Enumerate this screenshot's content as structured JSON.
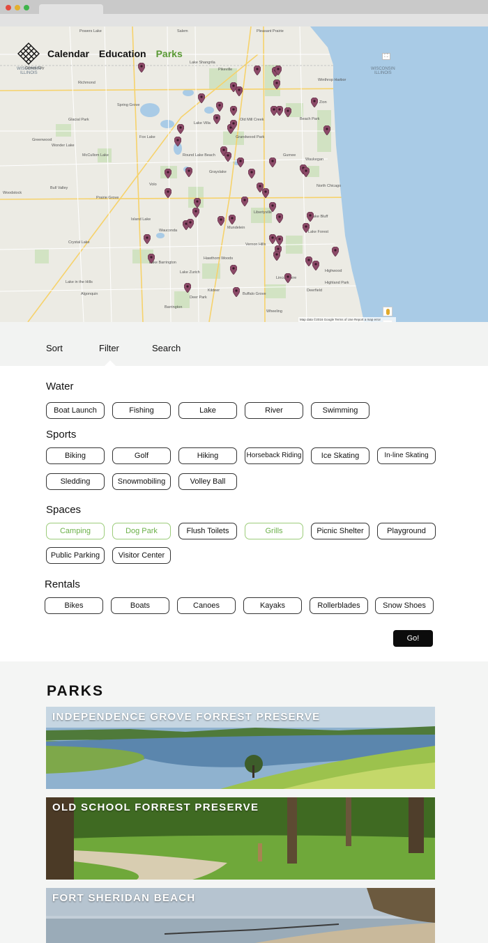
{
  "nav": {
    "links": [
      "Calendar",
      "Education",
      "Parks"
    ],
    "active": "Parks"
  },
  "map": {
    "lake_label": "WISCONSIN\nILLINOIS",
    "towns": [
      "Powers Lake",
      "Salem",
      "Pleasant Prairie",
      "Genoa City",
      "Lake Shangrila",
      "Pikeville",
      "Winthrop Harbor",
      "Richmond",
      "Spring Grove",
      "Zion",
      "Old Mill Creek",
      "Beach Park",
      "Glacial Park",
      "Lake Villa",
      "Greenwood",
      "Wonder Lake",
      "Fox Lake",
      "Grandwood Park",
      "Waukegan",
      "McCullom Lake",
      "Grayslake",
      "Gurnee",
      "Volo",
      "Round Lake Beach",
      "North Chicago",
      "Woodstock",
      "Bull Valley",
      "Prairie Grove",
      "Island Lake",
      "Libertyville",
      "Lake Bluff",
      "Crystal Lake",
      "Wauconda",
      "Mundelein",
      "Lake Forest",
      "Lake in the Hills",
      "Lake Barrington",
      "Hawthorn Woods",
      "Vernon Hills",
      "Highwood",
      "Algonquin",
      "Lake Zurich",
      "Lincolnshire",
      "Highland Park",
      "Barrington",
      "Deer Park",
      "Kildeer",
      "Buffalo Grove",
      "Deerfield",
      "Wheeling"
    ],
    "attribution": "Map data ©2016 Google   Terms of Use   Report a map error",
    "zoom_in": "+",
    "zoom_out": "−"
  },
  "tabs": {
    "sort": "Sort",
    "filter": "Filter",
    "search": "Search",
    "active": "Filter"
  },
  "filters": {
    "groups": [
      {
        "title": "Water",
        "options": [
          {
            "label": "Boat Launch",
            "selected": false
          },
          {
            "label": "Fishing",
            "selected": false
          },
          {
            "label": "Lake",
            "selected": false
          },
          {
            "label": "River",
            "selected": false
          },
          {
            "label": "Swimming",
            "selected": false
          }
        ]
      },
      {
        "title": "Sports",
        "options": [
          {
            "label": "Biking",
            "selected": false
          },
          {
            "label": "Golf",
            "selected": false
          },
          {
            "label": "Hiking",
            "selected": false
          },
          {
            "label": "Horseback Riding",
            "selected": false
          },
          {
            "label": "Ice Skating",
            "selected": false
          },
          {
            "label": "In-line Skating",
            "selected": false
          },
          {
            "label": "Sledding",
            "selected": false
          },
          {
            "label": "Snowmobiling",
            "selected": false
          },
          {
            "label": "Volley Ball",
            "selected": false
          }
        ]
      },
      {
        "title": "Spaces",
        "options": [
          {
            "label": "Camping",
            "selected": true
          },
          {
            "label": "Dog Park",
            "selected": true
          },
          {
            "label": "Flush Toilets",
            "selected": false
          },
          {
            "label": "Grills",
            "selected": true
          },
          {
            "label": "Picnic Shelter",
            "selected": false
          },
          {
            "label": "Playground",
            "selected": false
          },
          {
            "label": "Public Parking",
            "selected": false
          },
          {
            "label": "Visitor Center",
            "selected": false
          }
        ]
      },
      {
        "title": "Rentals",
        "options": [
          {
            "label": "Bikes",
            "selected": false
          },
          {
            "label": "Boats",
            "selected": false
          },
          {
            "label": "Canoes",
            "selected": false
          },
          {
            "label": "Kayaks",
            "selected": false
          },
          {
            "label": "Rollerblades",
            "selected": false
          },
          {
            "label": "Snow Shoes",
            "selected": false
          }
        ]
      }
    ],
    "go_label": "Go!"
  },
  "parks": {
    "heading": "PARKS",
    "items": [
      {
        "name": "INDEPENDENCE GROVE FORREST PRESERVE"
      },
      {
        "name": "OLD SCHOOL FORREST PRESERVE"
      },
      {
        "name": "FORT SHERIDAN BEACH"
      }
    ]
  },
  "colors": {
    "accent": "#5a9a35",
    "selected_chip": "#6bb048",
    "pin": "#8c4a68",
    "lake_michigan": "#a9cbe6",
    "button": "#0c0c0c"
  }
}
